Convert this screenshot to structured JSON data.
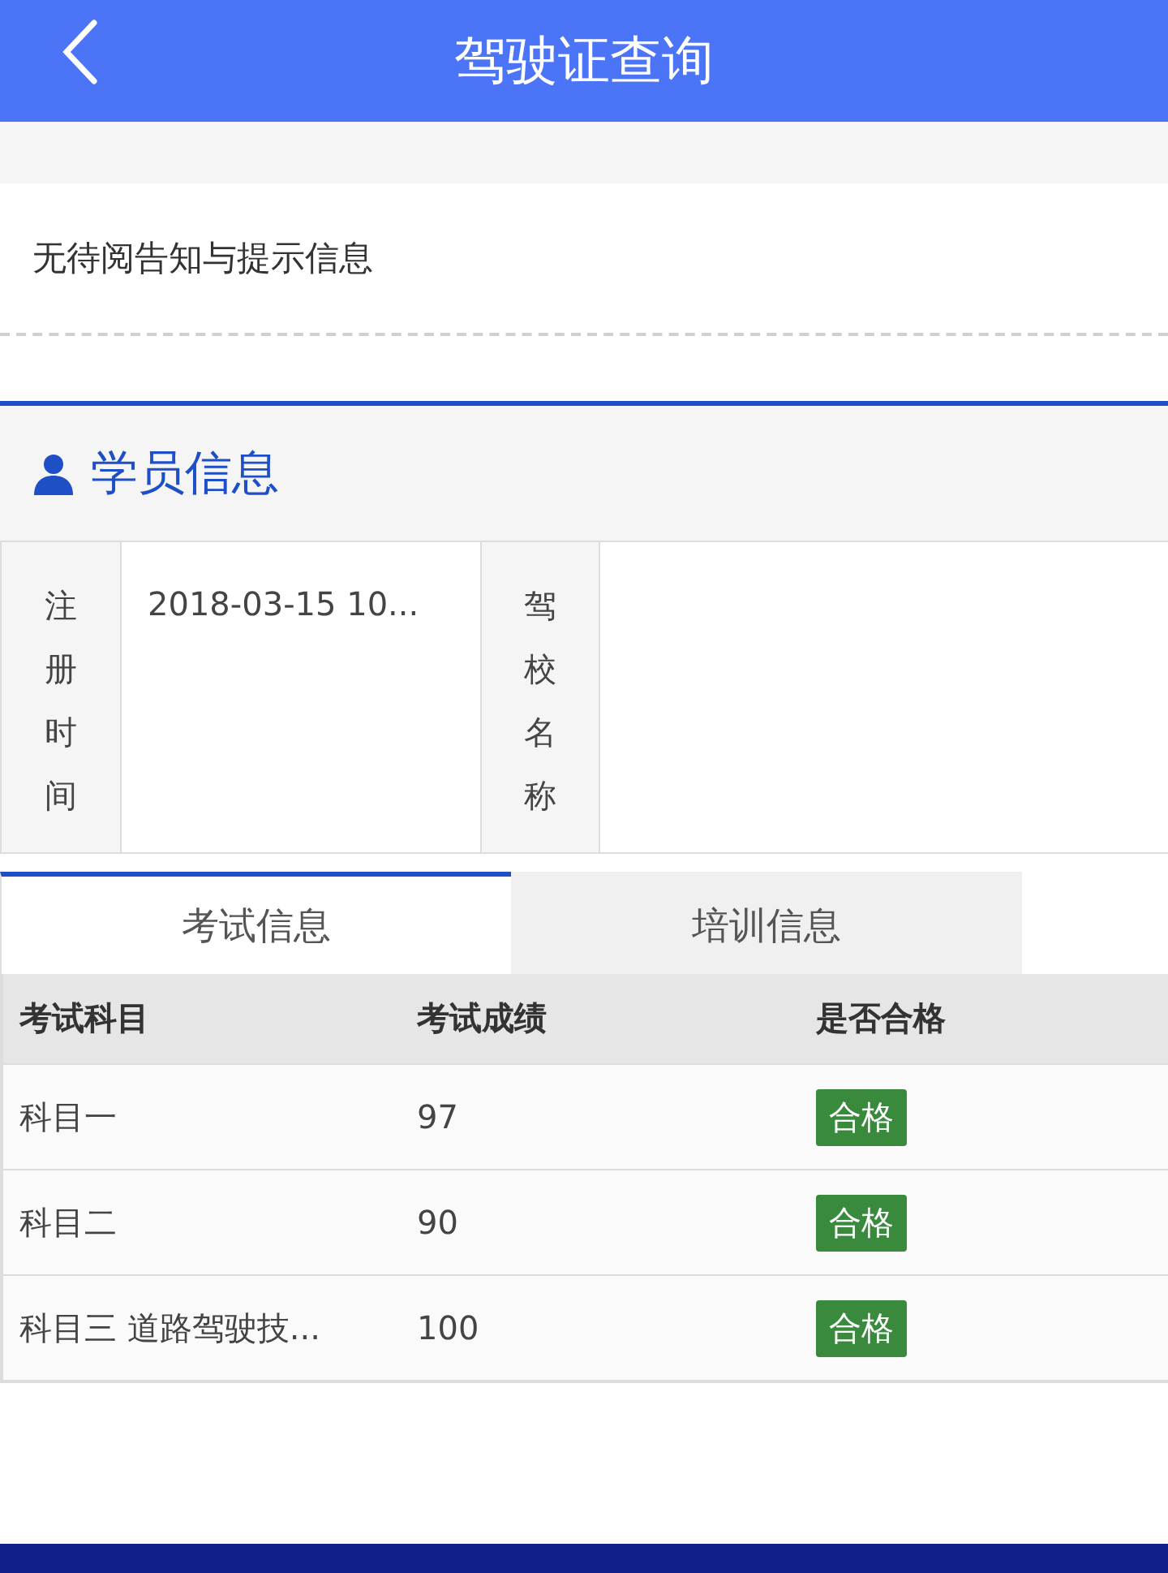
{
  "header": {
    "title": "驾驶证查询"
  },
  "notice": {
    "message": "无待阅告知与提示信息"
  },
  "student": {
    "title": "学员信息",
    "fields": [
      {
        "label": "注册时间",
        "value": "2018-03-15 10..."
      },
      {
        "label": "驾校名称"
      }
    ]
  },
  "tabs": [
    {
      "label": "考试信息",
      "selected": true
    },
    {
      "label": "培训信息",
      "selected": false
    }
  ],
  "table": {
    "columns": [
      "考试科目",
      "考试成绩",
      "是否合格"
    ],
    "rows": [
      {
        "subject": "科目一",
        "score": "97",
        "result": "合格"
      },
      {
        "subject": "科目二",
        "score": "90",
        "result": "合格"
      },
      {
        "subject": "科目三 道路驾驶技...",
        "score": "100",
        "result": "合格"
      }
    ]
  }
}
